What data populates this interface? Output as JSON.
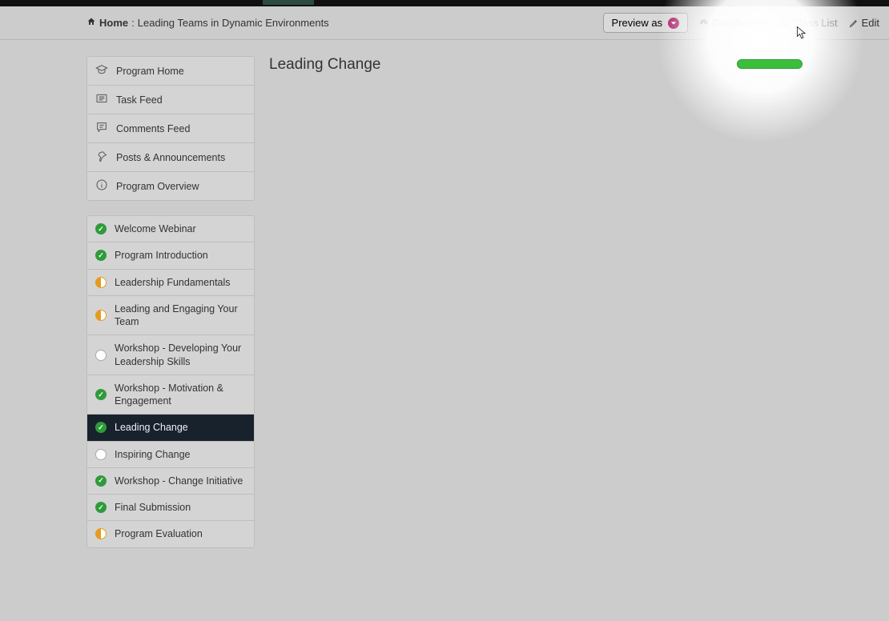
{
  "breadcrumb": {
    "home": "Home",
    "sep": ":",
    "title": "Leading Teams in Dynamic Environments"
  },
  "header": {
    "preview_label": "Preview as",
    "dashboards": "Dashboards",
    "class_list": "Class List",
    "edit": "Edit"
  },
  "nav": [
    {
      "label": "Program Home",
      "icon": "mortarboard"
    },
    {
      "label": "Task Feed",
      "icon": "list"
    },
    {
      "label": "Comments Feed",
      "icon": "comment"
    },
    {
      "label": "Posts & Announcements",
      "icon": "pin"
    },
    {
      "label": "Program Overview",
      "icon": "info"
    }
  ],
  "modules": [
    {
      "label": "Welcome Webinar",
      "status": "done"
    },
    {
      "label": "Program Introduction",
      "status": "done"
    },
    {
      "label": "Leadership Fundamentals",
      "status": "partial"
    },
    {
      "label": "Leading and Engaging Your Team",
      "status": "partial"
    },
    {
      "label": "Workshop - Developing Your Leadership Skills",
      "status": "empty"
    },
    {
      "label": "Workshop - Motivation & Engagement",
      "status": "done"
    },
    {
      "label": "Leading Change",
      "status": "done",
      "active": true
    },
    {
      "label": "Inspiring Change",
      "status": "empty"
    },
    {
      "label": "Workshop - Change Initiative",
      "status": "done"
    },
    {
      "label": "Final Submission",
      "status": "done"
    },
    {
      "label": "Program Evaluation",
      "status": "partial"
    }
  ],
  "page": {
    "title": "Leading Change",
    "progress_percent": 100
  }
}
